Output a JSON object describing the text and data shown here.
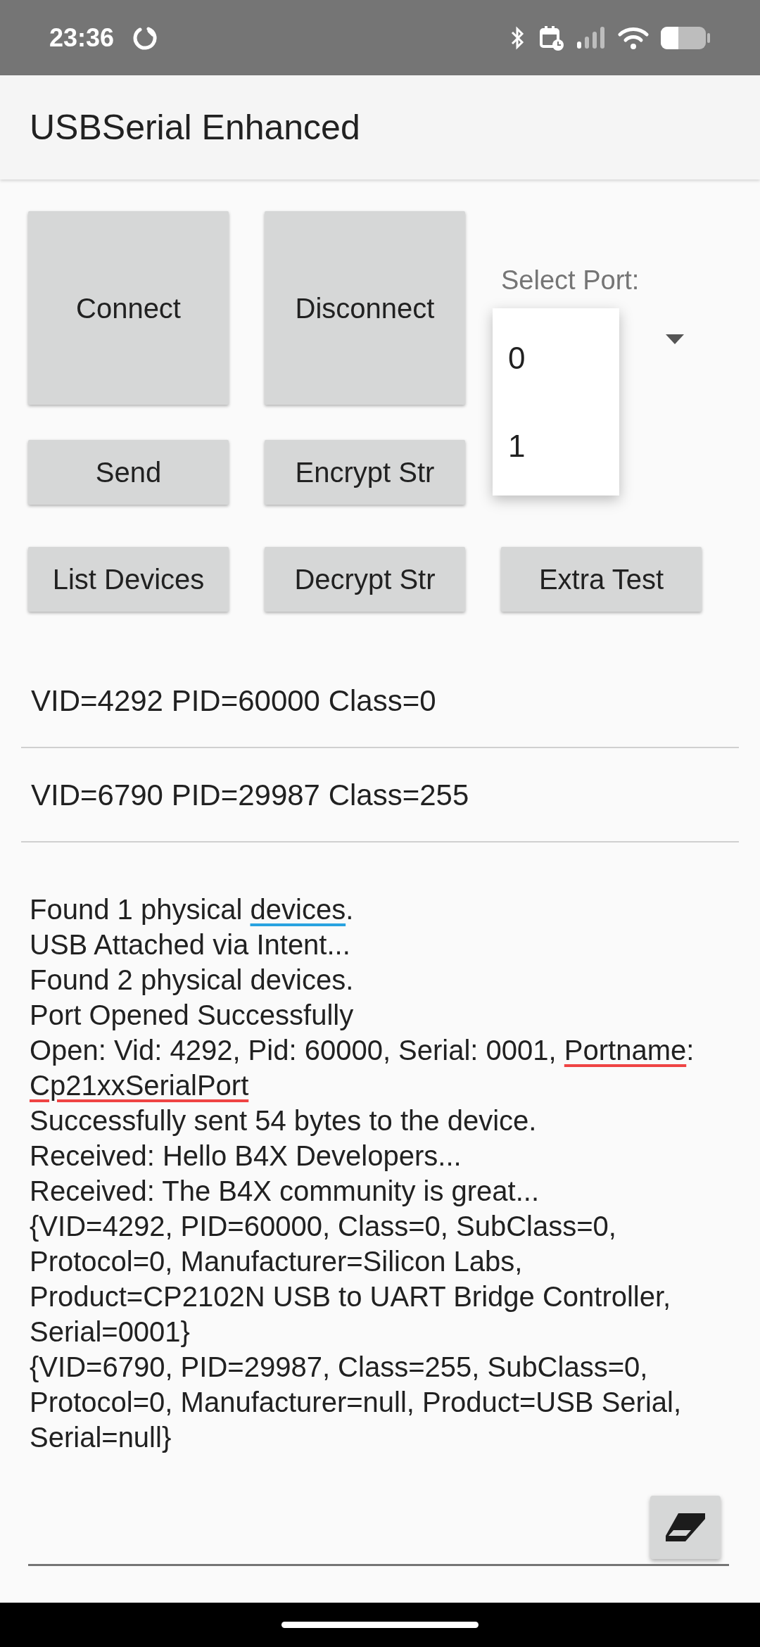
{
  "status_bar": {
    "time": "23:36"
  },
  "app_bar": {
    "title": "USBSerial Enhanced"
  },
  "buttons": [
    {
      "label": "Connect",
      "kind": "large"
    },
    {
      "label": "Disconnect",
      "kind": "large"
    },
    {
      "label": "Send",
      "kind": "small"
    },
    {
      "label": "Encrypt Str",
      "kind": "small"
    },
    {
      "label": "List Devices",
      "kind": "small"
    },
    {
      "label": "Decrypt Str",
      "kind": "small"
    },
    {
      "label": "Extra Test",
      "kind": "small"
    }
  ],
  "port_select": {
    "label": "Select Port:",
    "options": [
      "0",
      "1"
    ]
  },
  "device_list": [
    "VID=4292 PID=60000 Class=0",
    "VID=6790 PID=29987 Class=255"
  ],
  "log_lines": [
    [
      {
        "text": "Found 1 physical "
      },
      {
        "text": "devices",
        "kind": "grammar"
      },
      {
        "text": "."
      }
    ],
    [
      {
        "text": "USB Attached via Intent..."
      }
    ],
    [
      {
        "text": "Found 2 physical devices."
      }
    ],
    [
      {
        "text": "Port Opened Successfully"
      }
    ],
    [
      {
        "text": "Open: Vid: 4292, Pid: 60000, Serial: 0001, "
      },
      {
        "text": "Portname",
        "kind": "spelling"
      },
      {
        "text": ":"
      }
    ],
    [
      {
        "text": "Cp21xxSerialPort",
        "kind": "spelling"
      }
    ],
    [
      {
        "text": "Successfully sent 54 bytes to the device."
      }
    ],
    [
      {
        "text": "Received: Hello B4X Developers..."
      }
    ],
    [
      {
        "text": "Received: The B4X community is great..."
      }
    ],
    [
      {
        "text": "{VID=4292, PID=60000, Class=0, SubClass=0,"
      }
    ],
    [
      {
        "text": "Protocol=0, Manufacturer=Silicon Labs,"
      }
    ],
    [
      {
        "text": "Product=CP2102N USB to UART Bridge Controller,"
      }
    ],
    [
      {
        "text": "Serial=0001}"
      }
    ],
    [
      {
        "text": "{VID=6790, PID=29987, Class=255, SubClass=0,"
      }
    ],
    [
      {
        "text": "Protocol=0, Manufacturer=null, Product=USB Serial,"
      }
    ],
    [
      {
        "text": "Serial=null}"
      }
    ]
  ]
}
